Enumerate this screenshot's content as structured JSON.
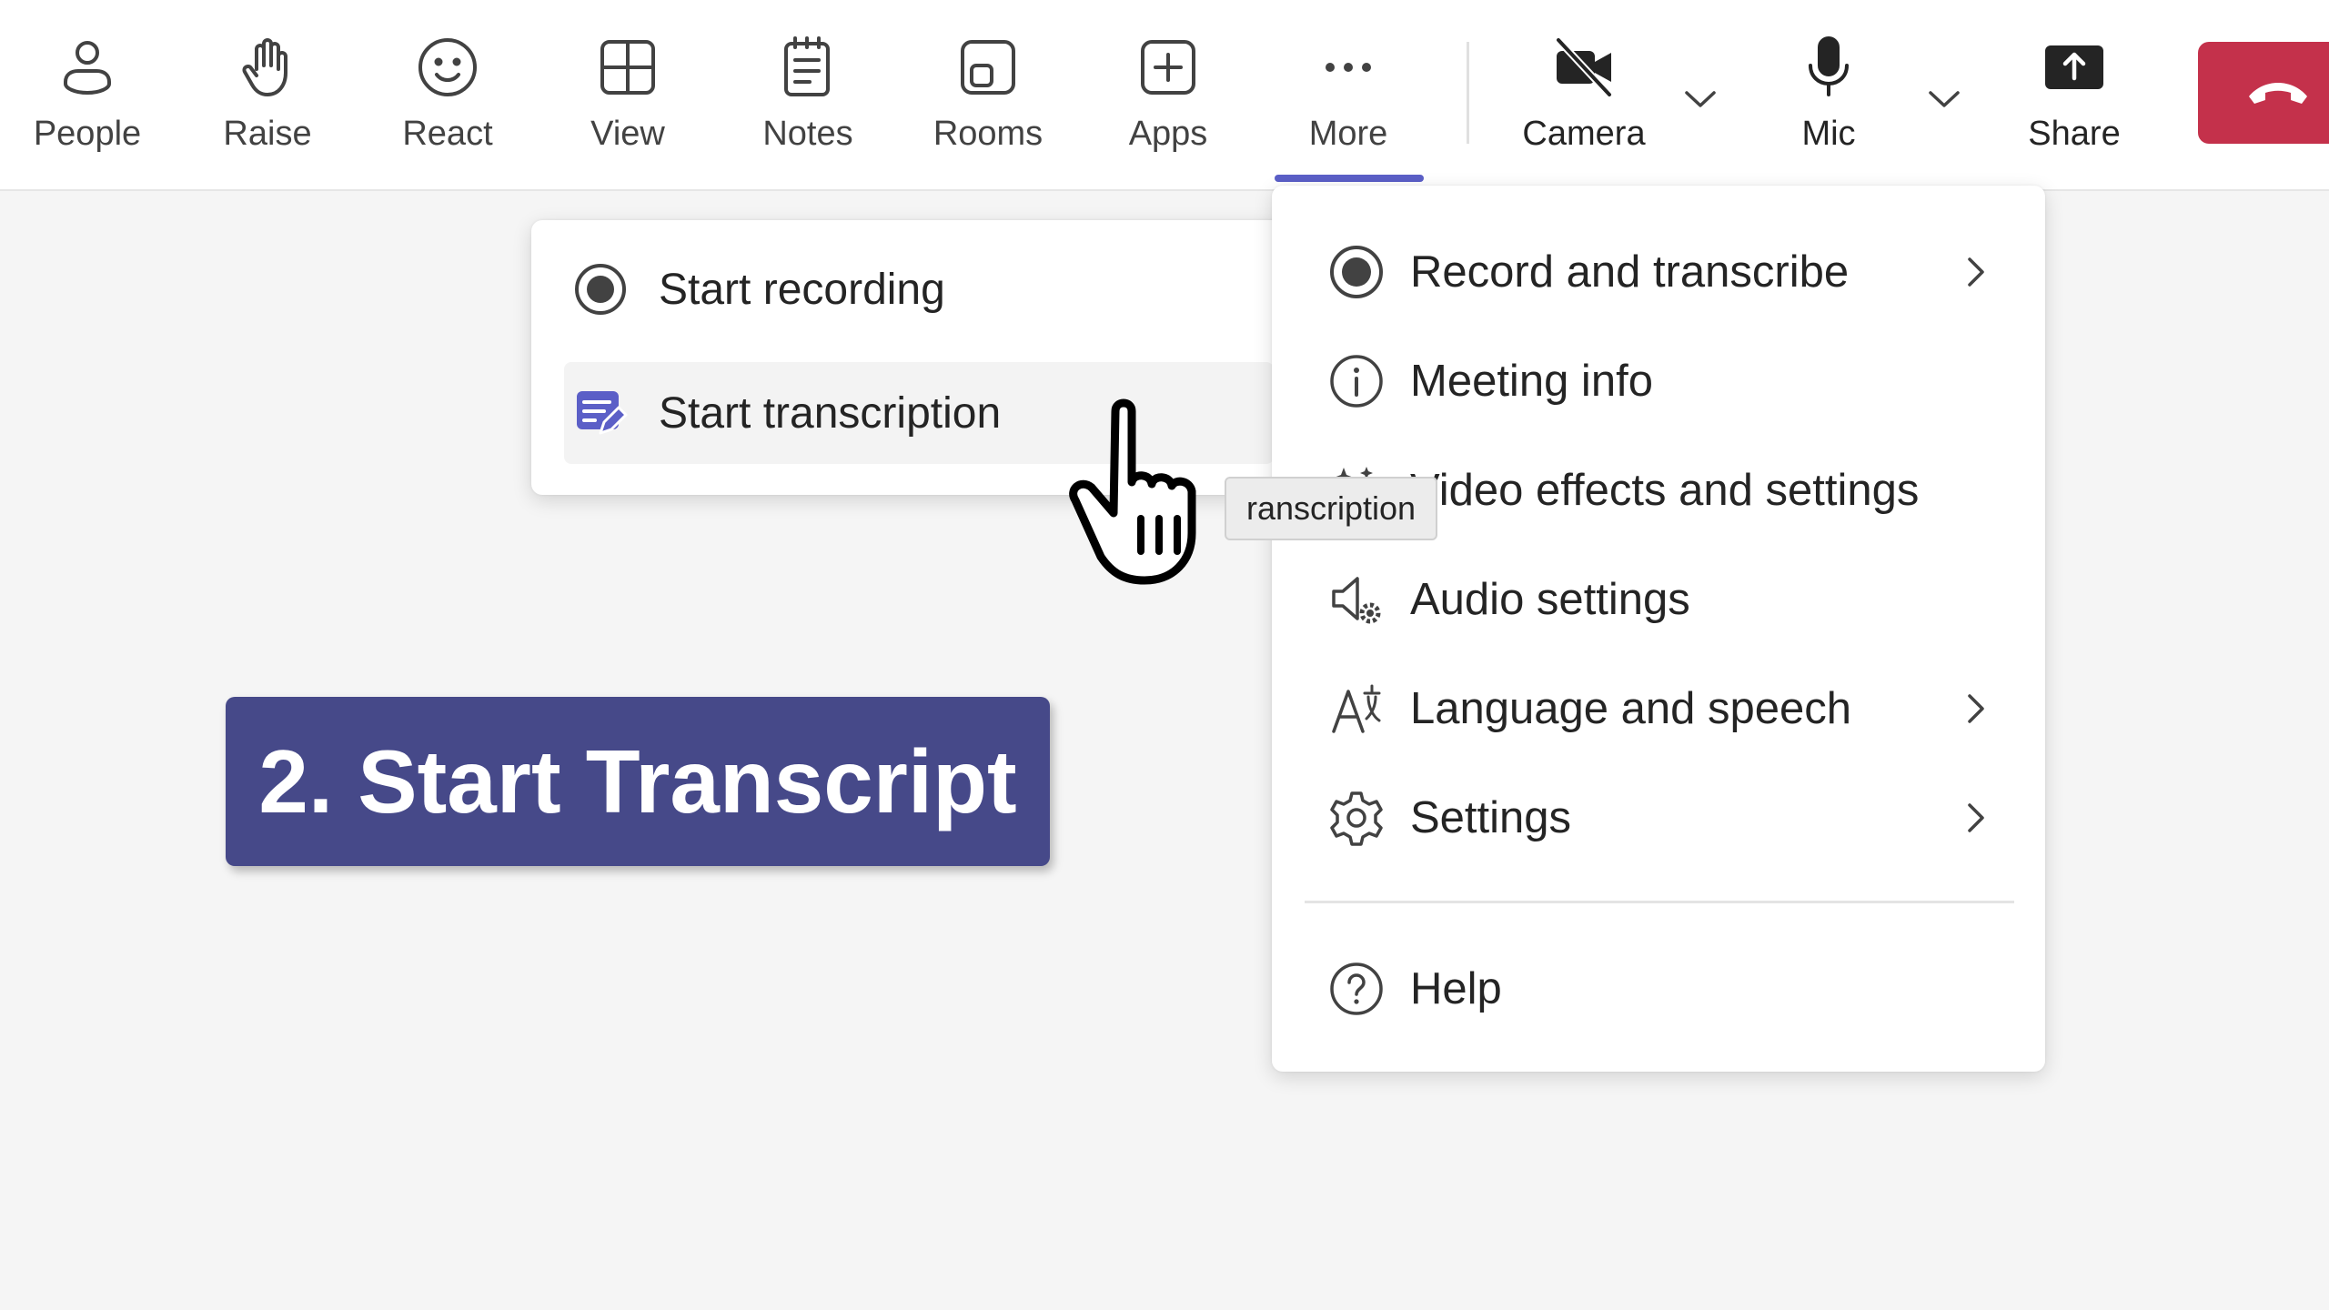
{
  "toolbar": {
    "people": "People",
    "raise": "Raise",
    "react": "React",
    "view": "View",
    "notes": "Notes",
    "rooms": "Rooms",
    "apps": "Apps",
    "more": "More",
    "camera": "Camera",
    "mic": "Mic",
    "share": "Share"
  },
  "submenu": {
    "start_recording": "Start recording",
    "start_transcription": "Start transcription"
  },
  "more_menu": {
    "record_and_transcribe": "Record and transcribe",
    "meeting_info": "Meeting info",
    "video_effects": "Video effects and settings",
    "audio_settings": "Audio settings",
    "language_and_speech": "Language and speech",
    "settings": "Settings",
    "help": "Help"
  },
  "tooltip": {
    "text": "ranscription"
  },
  "step_banner": {
    "text": "2. Start Transcript"
  },
  "colors": {
    "accent": "#5b5fc7",
    "leave": "#c4314b",
    "banner": "#464989",
    "background": "#f5f5f5"
  },
  "icons": {
    "people": "person-icon",
    "raise": "hand-icon",
    "react": "smiley-icon",
    "view": "grid-icon",
    "notes": "notepad-icon",
    "rooms": "rooms-icon",
    "apps": "plus-square-icon",
    "more": "ellipsis-icon",
    "camera": "camera-off-icon",
    "mic": "microphone-icon",
    "share": "share-icon",
    "leave": "hang-up-icon"
  }
}
